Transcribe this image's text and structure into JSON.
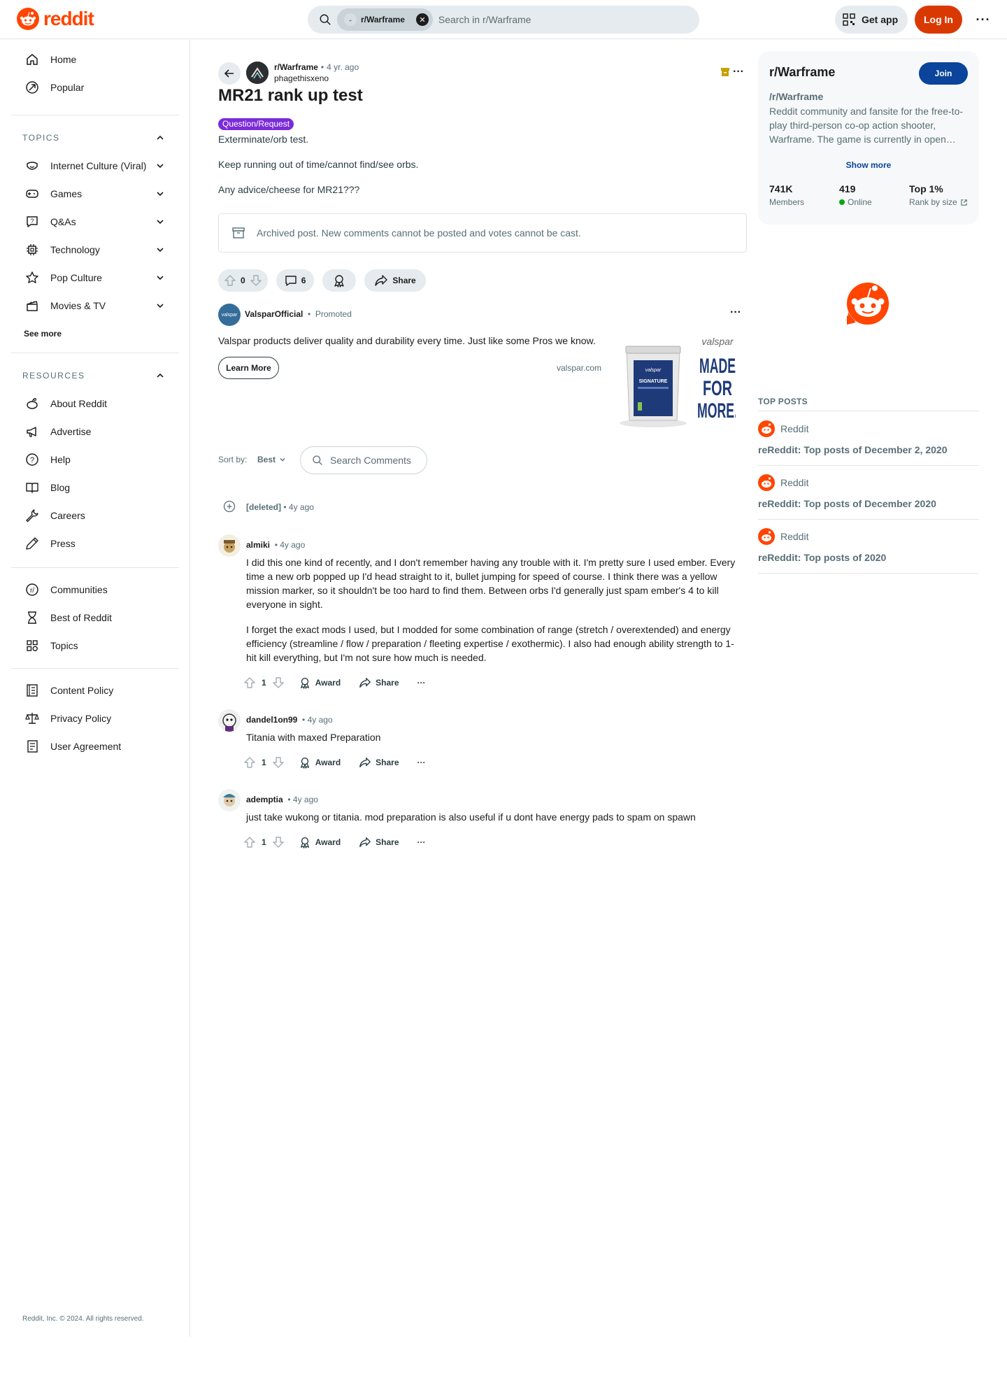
{
  "brand": {
    "name": "reddit",
    "color": "#ff4500"
  },
  "header": {
    "search_chip": "r/Warframe",
    "search_placeholder": "Search in r/Warframe",
    "get_app": "Get app",
    "login": "Log In"
  },
  "sidebar": {
    "top": [
      {
        "label": "Home",
        "icon": "home-icon"
      },
      {
        "label": "Popular",
        "icon": "popular-icon"
      }
    ],
    "topics_heading": "TOPICS",
    "topics": [
      {
        "label": "Internet Culture (Viral)",
        "icon": "smiley-icon"
      },
      {
        "label": "Games",
        "icon": "gamepad-icon"
      },
      {
        "label": "Q&As",
        "icon": "question-icon"
      },
      {
        "label": "Technology",
        "icon": "chip-icon"
      },
      {
        "label": "Pop Culture",
        "icon": "star-icon"
      },
      {
        "label": "Movies & TV",
        "icon": "clapperboard-icon"
      }
    ],
    "see_more": "See more",
    "resources_heading": "RESOURCES",
    "resources": [
      {
        "label": "About Reddit",
        "icon": "reddit-icon"
      },
      {
        "label": "Advertise",
        "icon": "megaphone-icon"
      },
      {
        "label": "Help",
        "icon": "help-icon"
      },
      {
        "label": "Blog",
        "icon": "book-icon"
      },
      {
        "label": "Careers",
        "icon": "wrench-icon"
      },
      {
        "label": "Press",
        "icon": "pen-icon"
      }
    ],
    "community": [
      {
        "label": "Communities",
        "icon": "communities-icon"
      },
      {
        "label": "Best of Reddit",
        "icon": "hourglass-icon"
      },
      {
        "label": "Topics",
        "icon": "topics-icon"
      }
    ],
    "policies": [
      {
        "label": "Content Policy",
        "icon": "policy-icon"
      },
      {
        "label": "Privacy Policy",
        "icon": "scales-icon"
      },
      {
        "label": "User Agreement",
        "icon": "agreement-icon"
      }
    ],
    "copyright": "Reddit, Inc. © 2024. All rights reserved."
  },
  "post": {
    "subreddit": "r/Warframe",
    "separator": "•",
    "time": "4 yr. ago",
    "author": "phagethisxeno",
    "title": "MR21 rank up test",
    "flair": "Question/Request",
    "body": [
      "Exterminate/orb test.",
      "Keep running out of time/cannot find/see orbs.",
      "Any advice/cheese for MR21???"
    ],
    "archived_notice": "Archived post. New comments cannot be posted and votes cannot be cast.",
    "score": "0",
    "comments": "6",
    "share": "Share"
  },
  "ad": {
    "advertiser": "ValsparOfficial",
    "avatar_text": "valspar",
    "separator": "•",
    "promoted": "Promoted",
    "text": "Valspar products deliver quality and durability every time. Just like some Pros we know.",
    "cta": "Learn More",
    "domain": "valspar.com",
    "image_brand": "valspar",
    "image_slogan": [
      "MADE",
      "FOR",
      "MORE."
    ],
    "can_label": "SIGNATURE"
  },
  "comments_section": {
    "sort_label": "Sort by:",
    "sort_value": "Best",
    "search_placeholder": "Search Comments",
    "deleted": {
      "author": "[deleted]",
      "time": "• 4y ago"
    },
    "items": [
      {
        "author": "almiki",
        "time": "• 4y ago",
        "paragraphs": [
          "I did this one kind of recently, and I don't remember having any trouble with it. I'm pretty sure I used ember. Every time a new orb popped up I'd head straight to it, bullet jumping for speed of course. I think there was a yellow mission marker, so it shouldn't be too hard to find them. Between orbs I'd generally just spam ember's 4 to kill everyone in sight.",
          "I forget the exact mods I used, but I modded for some combination of range (stretch / overextended) and energy efficiency (streamline / flow / preparation / fleeting expertise / exothermic). I also had enough ability strength to 1-hit kill everything, but I'm not sure how much is needed."
        ],
        "score": "1",
        "award": "Award",
        "share": "Share"
      },
      {
        "author": "dandel1on99",
        "time": "• 4y ago",
        "paragraphs": [
          "Titania with maxed Preparation"
        ],
        "score": "1",
        "award": "Award",
        "share": "Share"
      },
      {
        "author": "ademptia",
        "time": "• 4y ago",
        "paragraphs": [
          "just take wukong or titania. mod preparation is also useful if u dont have energy pads to spam on spawn"
        ],
        "score": "1",
        "award": "Award",
        "share": "Share"
      }
    ]
  },
  "subreddit_card": {
    "title": "r/Warframe",
    "join": "Join",
    "name": "/r/Warframe",
    "description": "Reddit community and fansite for the free-to-play third-person co-op action shooter, Warframe. The game is currently in open…",
    "show_more": "Show more",
    "stats": [
      {
        "value": "741K",
        "label": "Members"
      },
      {
        "value": "419",
        "label": "Online"
      },
      {
        "value": "Top 1%",
        "label": "Rank by size"
      }
    ]
  },
  "top_posts": {
    "heading": "TOP POSTS",
    "items": [
      {
        "source": "Reddit",
        "title": "reReddit: Top posts of December 2, 2020"
      },
      {
        "source": "Reddit",
        "title": "reReddit: Top posts of December 2020"
      },
      {
        "source": "Reddit",
        "title": "reReddit: Top posts of 2020"
      }
    ]
  }
}
